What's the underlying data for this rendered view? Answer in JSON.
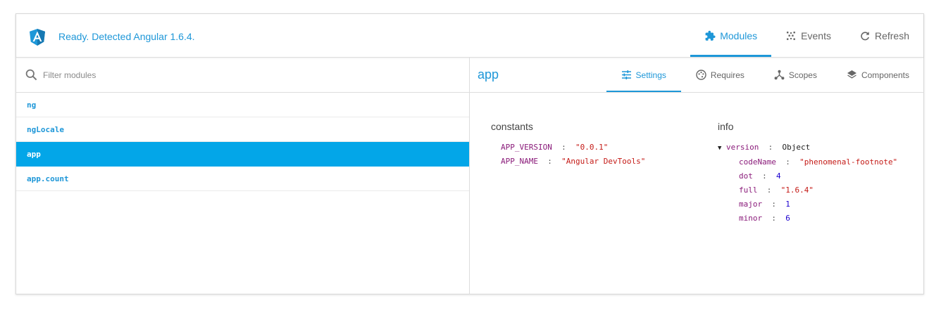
{
  "header": {
    "status": "Ready. Detected Angular 1.6.4.",
    "nav": [
      {
        "label": "Modules",
        "icon": "puzzle-icon",
        "active": true
      },
      {
        "label": "Events",
        "icon": "events-icon",
        "active": false
      },
      {
        "label": "Refresh",
        "icon": "refresh-icon",
        "active": false
      }
    ]
  },
  "search": {
    "placeholder": "Filter modules"
  },
  "modules": [
    "ng",
    "ngLocale",
    "app",
    "app.count"
  ],
  "selected_module": "app",
  "detail": {
    "title": "app",
    "tabs": [
      {
        "label": "Settings",
        "icon": "sliders-icon",
        "active": true
      },
      {
        "label": "Requires",
        "icon": "palette-icon",
        "active": false
      },
      {
        "label": "Scopes",
        "icon": "tree-icon",
        "active": false
      },
      {
        "label": "Components",
        "icon": "layers-icon",
        "active": false
      }
    ],
    "constants": {
      "title": "constants",
      "items": [
        {
          "key": "APP_VERSION",
          "value": "\"0.0.1\""
        },
        {
          "key": "APP_NAME",
          "value": "\"Angular DevTools\""
        }
      ]
    },
    "info": {
      "title": "info",
      "root_key": "version",
      "root_type": "Object",
      "items": [
        {
          "key": "codeName",
          "value": "\"phenomenal-footnote\"",
          "type": "string"
        },
        {
          "key": "dot",
          "value": "4",
          "type": "number"
        },
        {
          "key": "full",
          "value": "\"1.6.4\"",
          "type": "string"
        },
        {
          "key": "major",
          "value": "1",
          "type": "number"
        },
        {
          "key": "minor",
          "value": "6",
          "type": "number"
        }
      ]
    }
  },
  "colors": {
    "accent": "#1e97d8",
    "selected": "#03a6e8",
    "key": "#8a1b7a",
    "string": "#c41a16",
    "number": "#1c00cf"
  }
}
